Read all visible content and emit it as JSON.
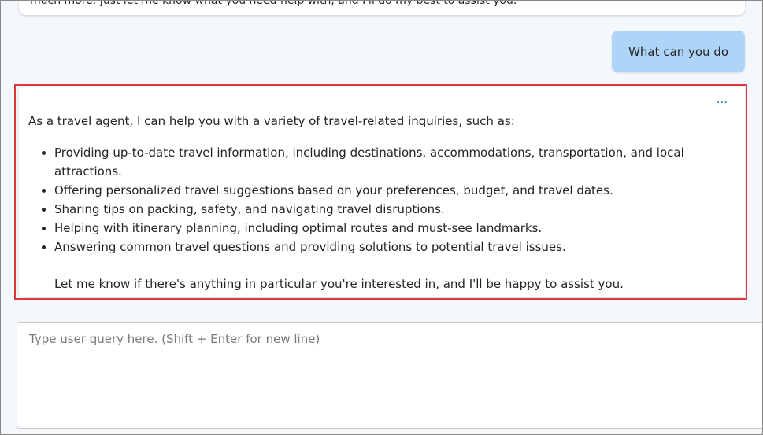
{
  "conversation": {
    "previous_assistant_message_tail": "much more. Just let me know what you need help with, and I'll do my best to assist you.",
    "user_message": "What can you do",
    "assistant_message": {
      "more_options_label": "...",
      "intro": "As a travel agent, I can help you with a variety of travel-related inquiries, such as:",
      "items": [
        "Providing up-to-date travel information, including destinations, accommodations, transportation, and local attractions.",
        "Offering personalized travel suggestions based on your preferences, budget, and travel dates.",
        "Sharing tips on packing, safety, and navigating travel disruptions.",
        "Helping with itinerary planning, including optimal routes and must-see landmarks.",
        "Answering common travel questions and providing solutions to potential travel issues."
      ],
      "closing": "Let me know if there's anything in particular you're interested in, and I'll be happy to assist you."
    }
  },
  "composer": {
    "placeholder": "Type user query here. (Shift + Enter for new line)",
    "value": ""
  },
  "colors": {
    "user_bubble": "#aed5f8",
    "highlight_border": "#e0393d",
    "accent": "#1f6fc5",
    "background": "#f4f7fc"
  }
}
